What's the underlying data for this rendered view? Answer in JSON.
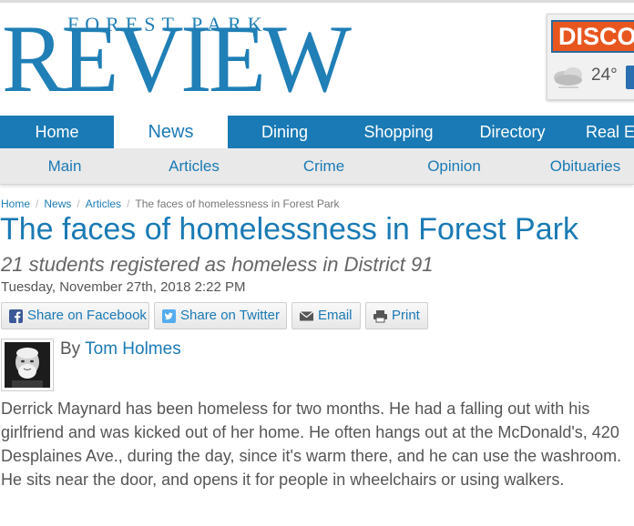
{
  "masthead": {
    "logo_top": "FOREST PARK",
    "logo_main": "REVIEW",
    "promo_label": "DISCOV",
    "weather_temp": "24°",
    "weather_icon": "cloud-icon"
  },
  "main_nav": {
    "items": [
      {
        "label": "Home"
      },
      {
        "label": "News"
      },
      {
        "label": "Dining"
      },
      {
        "label": "Shopping"
      },
      {
        "label": "Directory"
      },
      {
        "label": "Real Es"
      }
    ],
    "active": "News"
  },
  "sub_nav": {
    "items": [
      {
        "label": "Main"
      },
      {
        "label": "Articles"
      },
      {
        "label": "Crime"
      },
      {
        "label": "Opinion"
      },
      {
        "label": "Obituaries"
      }
    ]
  },
  "breadcrumb": {
    "items": [
      "Home",
      "News",
      "Articles"
    ],
    "current": "The faces of homelessness in Forest Park",
    "separator": "/"
  },
  "article": {
    "title": "The faces of homelessness in Forest Park",
    "subtitle": "21 students registered as homeless in District 91",
    "date": "Tuesday, November 27th, 2018 2:22 PM",
    "byline_prefix": "By",
    "author": "Tom Holmes",
    "body": "Derrick Maynard has been homeless for two months. He had a falling out with his girlfriend and was kicked out of her home. He often hangs out at the McDonald's, 420 Desplaines Ave., during the day, since it's warm there, and he can use the washroom. He sits near the door, and opens it for people in wheelchairs or using walkers."
  },
  "share": {
    "facebook": "Share on Facebook",
    "twitter": "Share on Twitter",
    "email": "Email",
    "print": "Print"
  },
  "colors": {
    "brand_blue": "#1a7ab5",
    "promo_orange": "#e8561f"
  }
}
